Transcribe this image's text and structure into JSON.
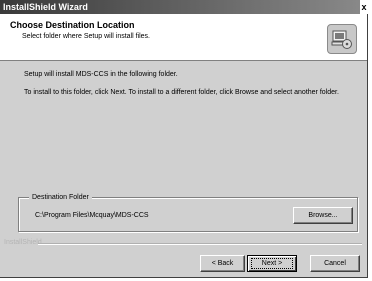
{
  "window": {
    "title": "InstallShield Wizard",
    "close_glyph": "x"
  },
  "header": {
    "title": "Choose Destination Location",
    "subtitle": "Select folder where Setup will install files.",
    "icon": "setup-computer-icon"
  },
  "body": {
    "line1": "Setup will install MDS-CCS in the following folder.",
    "line2": "To install to this folder, click Next. To install to a different folder, click Browse and select another folder."
  },
  "destination": {
    "legend": "Destination Folder",
    "path": "C:\\Program Files\\Mcquay\\MDS-CCS",
    "browse_label": "Browse..."
  },
  "footer": {
    "brand": "InstallShield",
    "back_label": "< Back",
    "next_label": "Next >",
    "cancel_label": "Cancel"
  }
}
